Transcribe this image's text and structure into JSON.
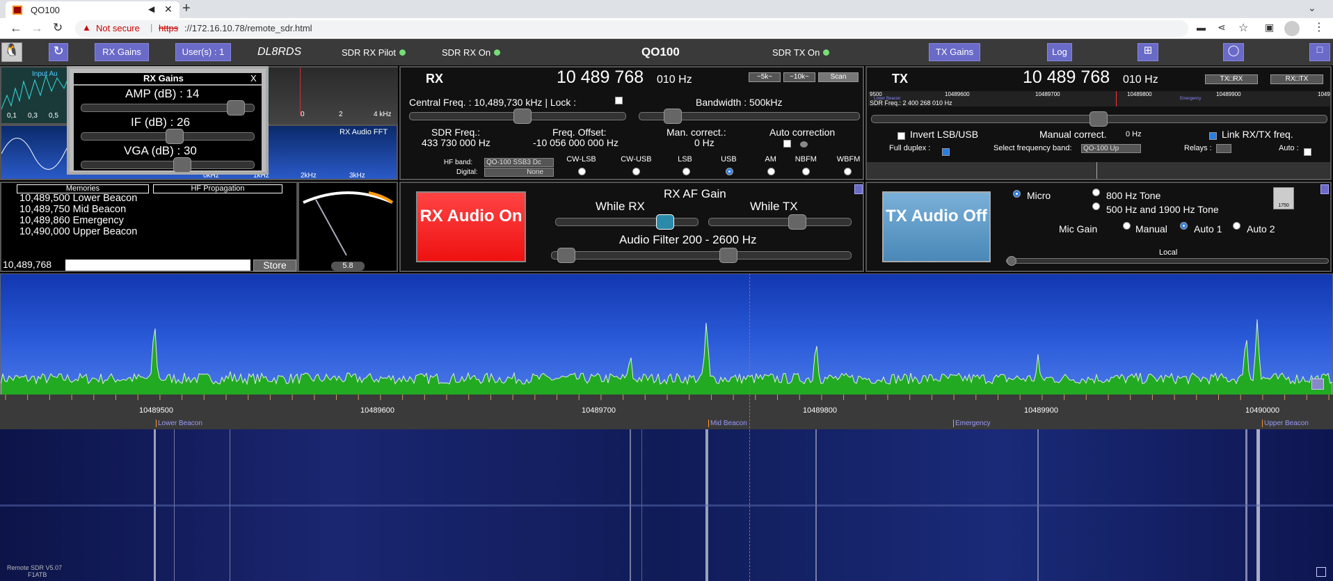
{
  "browser": {
    "tab_title": "QO100",
    "security_label": "Not secure",
    "url_scheme": "https",
    "url_rest": "://172.16.10.78/remote_sdr.html"
  },
  "topbar": {
    "rx_gains": "RX Gains",
    "users": "User(s) : 1",
    "callsign": "DL8RDS",
    "sdr_rx_pilot": "SDR RX Pilot",
    "sdr_rx_on": "SDR RX On",
    "title": "QO100",
    "sdr_tx_on": "SDR TX On",
    "tx_gains": "TX Gains",
    "log": "Log"
  },
  "rx_gains_popup": {
    "title": "RX Gains",
    "close": "X",
    "amp": "AMP (dB) : 14",
    "if": "IF (dB) : 26",
    "vga": "VGA (dB) : 30",
    "amp_level": 0.95,
    "if_level": 0.55,
    "vga_level": 0.6
  },
  "audio_fft": {
    "input_label": "Input Au",
    "input_ticks": [
      "0,1",
      "0,3",
      "0,5"
    ],
    "scope_ticks": [
      "0",
      "2",
      "4 kHz"
    ],
    "rx_audio_fft": "RX Audio FFT",
    "fft_ticks": [
      "0kHz",
      "1kHz",
      "2kHz",
      "3kHz"
    ]
  },
  "memories": {
    "tab_memories": "Memories",
    "tab_hf": "HF Propagation",
    "items": [
      "10,489,500 Lower Beacon",
      "10,489,750 Mid Beacon",
      "10,489,860 Emergency",
      "10,490,000 Upper Beacon"
    ],
    "freq_value": "10,489,768",
    "store": "Store"
  },
  "smeter": {
    "value": "5.8"
  },
  "rx": {
    "title": "RX",
    "freq_main": "10 489 768",
    "freq_sub": "010 Hz",
    "btn_5k": "~5k~",
    "btn_10k": "~10k~",
    "btn_scan": "Scan",
    "central_freq": "Central Freq. :  10,489,730 kHz | Lock :",
    "bandwidth": "Bandwidth :  500kHz",
    "sdr_freq_label": "SDR Freq.:",
    "sdr_freq_value": "433 730 000 Hz",
    "offset_label": "Freq. Offset:",
    "offset_value": "-10 056 000 000 Hz",
    "man_correct_label": "Man. correct.:",
    "man_correct_value": "0 Hz",
    "auto_correction": "Auto correction",
    "hf_band_label": "HF band:",
    "hf_band_value": "QO-100 SSB3 Dc",
    "digital_label": "Digital:",
    "digital_value": "None",
    "modes": [
      "CW-LSB",
      "CW-USB",
      "LSB",
      "USB",
      "AM",
      "NBFM",
      "WBFM"
    ],
    "selected_mode": "USB",
    "central_level": 0.53,
    "bandwidth_level": 0.12
  },
  "rx_audio": {
    "button": "RX Audio On",
    "af_gain": "RX AF Gain",
    "while_rx": "While RX",
    "while_tx": "While TX",
    "filter": "Audio Filter 200 - 2600 Hz",
    "while_rx_level": 0.82,
    "while_tx_level": 0.65,
    "filter_low": 0.02,
    "filter_high": 0.6
  },
  "tx": {
    "title": "TX",
    "freq_main": "10 489 768",
    "freq_sub": "010 Hz",
    "btn_txrx": "TX□RX",
    "btn_rxtx": "RX□TX",
    "scale_ticks": [
      "9500",
      "10489600",
      "10489700",
      "10489800",
      "10489900",
      "1049"
    ],
    "scale_labels": [
      "Lower Beacon",
      "Emergency"
    ],
    "sdr_freq": "SDR Freq.: 2 400 268 010 Hz",
    "invert": "Invert LSB/USB",
    "manual_correct": "Manual correct.",
    "manual_value": "0 Hz",
    "link": "Link RX/TX freq.",
    "full_duplex": "Full duplex :",
    "select_band": "Select frequency band:",
    "band_value": "QO-100 Up",
    "relays": "Relays :",
    "auto": "Auto :",
    "tx_level": 0.5
  },
  "tx_audio": {
    "button": "TX Audio Off",
    "micro": "Micro",
    "tone_800": "800 Hz Tone",
    "tone_500": "500 Hz and 1900 Hz Tone",
    "mic_gain": "Mic Gain",
    "manual": "Manual",
    "auto1": "Auto 1",
    "auto2": "Auto 2",
    "local": "Local",
    "keypad_value": "1750"
  },
  "spectrum": {
    "ticks": [
      "10489500",
      "10489600",
      "10489700",
      "10489800",
      "10489900",
      "10490000"
    ],
    "markers": [
      "Lower Beacon",
      "Mid Beacon",
      "Emergency",
      "Upper Beacon"
    ]
  },
  "footer": {
    "version": "Remote SDR V5.07",
    "author": "F1ATB"
  },
  "colors": {
    "accent": "#6a6ac8",
    "rx_on": "#ff3333",
    "tx_off": "#6aa0c8",
    "spectrum_bg": "#1e44c4",
    "signal": "#22aa22"
  }
}
